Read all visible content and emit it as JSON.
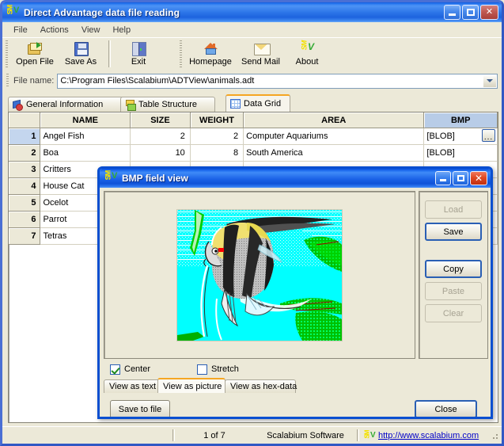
{
  "window": {
    "title": "Direct Advantage data file reading",
    "icon": "adv-app-icon",
    "buttons": {
      "minimize": "minimize-button",
      "maximize": "maximize-button",
      "close": "close-button"
    }
  },
  "menu": {
    "items": [
      "File",
      "Actions",
      "View",
      "Help"
    ]
  },
  "toolbar": {
    "groups": [
      {
        "items": [
          {
            "label": "Open File",
            "icon": "open-folder-icon"
          },
          {
            "label": "Save As",
            "icon": "floppy-disk-icon"
          }
        ]
      },
      {
        "items": [
          {
            "label": "Exit",
            "icon": "exit-door-icon"
          }
        ]
      },
      {
        "items": [
          {
            "label": "Homepage",
            "icon": "home-icon"
          },
          {
            "label": "Send Mail",
            "icon": "envelope-icon"
          },
          {
            "label": "About",
            "icon": "adv-logo-icon"
          }
        ]
      }
    ]
  },
  "file_row": {
    "label": "File name:",
    "value": "C:\\Program Files\\Scalabium\\ADTView\\animals.adt",
    "placeholder": "C:\\"
  },
  "tabs": [
    {
      "label": "General Information",
      "icon": "shapes-icon",
      "active": false
    },
    {
      "label": "Table Structure",
      "icon": "structure-icon",
      "active": false
    },
    {
      "label": "Data Grid",
      "icon": "grid-icon",
      "active": true
    }
  ],
  "grid": {
    "columns": [
      "",
      "NAME",
      "SIZE",
      "WEIGHT",
      "AREA",
      "BMP"
    ],
    "rows": [
      {
        "n": "1",
        "name": "Angel Fish",
        "size": "2",
        "weight": "2",
        "area": "Computer Aquariums",
        "bmp": "[BLOB]",
        "selected": true,
        "has_button": true
      },
      {
        "n": "2",
        "name": "Boa",
        "size": "10",
        "weight": "8",
        "area": "South America",
        "bmp": "[BLOB]",
        "selected": false,
        "has_button": false
      },
      {
        "n": "3",
        "name": "Critters",
        "size": "",
        "weight": "",
        "area": "",
        "bmp": "",
        "selected": false,
        "has_button": false
      },
      {
        "n": "4",
        "name": "House Cat",
        "size": "",
        "weight": "",
        "area": "",
        "bmp": "",
        "selected": false,
        "has_button": false
      },
      {
        "n": "5",
        "name": "Ocelot",
        "size": "",
        "weight": "",
        "area": "",
        "bmp": "",
        "selected": false,
        "has_button": false
      },
      {
        "n": "6",
        "name": "Parrot",
        "size": "",
        "weight": "",
        "area": "",
        "bmp": "",
        "selected": false,
        "has_button": false
      },
      {
        "n": "7",
        "name": "Tetras",
        "size": "",
        "weight": "",
        "area": "",
        "bmp": "",
        "selected": false,
        "has_button": false
      }
    ],
    "ellipsis_label": "..."
  },
  "statusbar": {
    "record": "1 of 7",
    "vendor": "Scalabium Software",
    "link": "http://www.scalabium.com",
    "link_icon": "adv-logo-icon"
  },
  "dialog": {
    "title": "BMP field view",
    "icon": "adv-app-icon",
    "buttons": {
      "minimize": "minimize-button",
      "maximize": "maximize-button",
      "close": "close-button"
    },
    "side_buttons": [
      {
        "label": "Load",
        "state": "disabled"
      },
      {
        "label": "Save",
        "state": "default"
      },
      {
        "label": "Copy",
        "state": "default"
      },
      {
        "label": "Paste",
        "state": "disabled"
      },
      {
        "label": "Clear",
        "state": "disabled"
      }
    ],
    "checkboxes": [
      {
        "label": "Center",
        "checked": true
      },
      {
        "label": "Stretch",
        "checked": false
      }
    ],
    "tabs": [
      {
        "label": "View as text",
        "active": false
      },
      {
        "label": "View as picture",
        "active": true
      },
      {
        "label": "View as hex-data",
        "active": false
      }
    ],
    "save_to_file_label": "Save to file",
    "close_label": "Close",
    "picture": "angelfish-bitmap"
  },
  "colors": {
    "titlebar_blue": "#1b62e6",
    "face": "#ece9d8",
    "tab_accent": "#f5a623",
    "header_selected": "#b8cce7",
    "link": "#0000c8"
  }
}
